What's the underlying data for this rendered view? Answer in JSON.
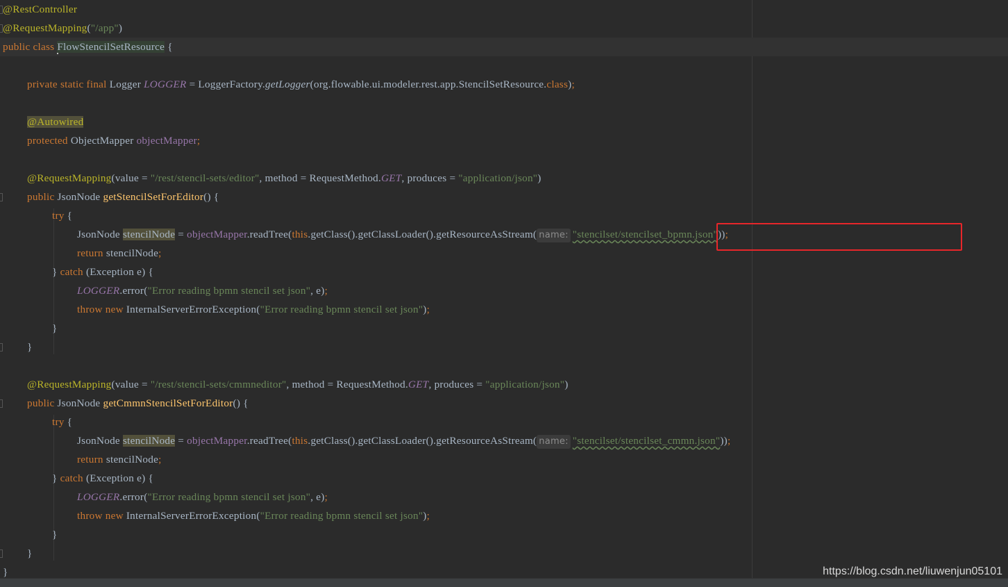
{
  "editor": {
    "class_annotations": [
      "@RestController",
      "@RequestMapping"
    ],
    "request_mapping_path": "\"/app\"",
    "class_decl": {
      "modifiers": "public class ",
      "name": "FlowStencilSetResource",
      "open": " {"
    },
    "logger_line": {
      "modifiers": "private static final ",
      "type": "Logger ",
      "name": "LOGGER",
      "assign": " = LoggerFactory.",
      "method": "getLogger",
      "arg": "(org.flowable.ui.modeler.rest.app.StencilSetResource.",
      "class_kw": "class",
      "close": ")",
      "semi": ";"
    },
    "autowired": "@Autowired",
    "mapper_line": {
      "modifier": "protected ",
      "type": "ObjectMapper ",
      "name": "objectMapper",
      "semi": ";"
    },
    "methods": [
      {
        "annotation": "@RequestMapping",
        "value_key": "(value = ",
        "value": "\"/rest/stencil-sets/editor\"",
        "method_key": ", method = RequestMethod.",
        "method_value": "GET",
        "produces_key": ", produces = ",
        "produces_value": "\"application/json\"",
        "close": ")",
        "signature_mod": "public ",
        "return_type": "JsonNode ",
        "name": "getStencilSetForEditor",
        "sig_close": "() {",
        "try_kw": "try",
        "assign_type": "JsonNode ",
        "var": "stencilNode",
        "assign_mid": " = ",
        "mapper": "objectMapper",
        "read_call": ".readTree(",
        "this_kw": "this",
        "chain": ".getClass().getClassLoader().getResourceAsStream(",
        "hint": "name:",
        "resource": "\"stencilset/stencilset_bpmn.json\"",
        "call_close": "))",
        "return_kw": "return",
        "return_var": " stencilNode",
        "catch_kw": "catch",
        "catch_arg": " (Exception e) {",
        "log_field": "LOGGER",
        "log_call": ".error(",
        "log_msg": "\"Error reading bpmn stencil set json\"",
        "log_tail": ", e)",
        "throw_kw": "throw",
        "new_kw": "new",
        "exception": " InternalServerErrorException(",
        "throw_msg": "\"Error reading bpmn stencil set json\"",
        "throw_close": ")"
      },
      {
        "annotation": "@RequestMapping",
        "value_key": "(value = ",
        "value": "\"/rest/stencil-sets/cmmneditor\"",
        "method_key": ", method = RequestMethod.",
        "method_value": "GET",
        "produces_key": ", produces = ",
        "produces_value": "\"application/json\"",
        "close": ")",
        "signature_mod": "public ",
        "return_type": "JsonNode ",
        "name": "getCmmnStencilSetForEditor",
        "sig_close": "() {",
        "try_kw": "try",
        "assign_type": "JsonNode ",
        "var": "stencilNode",
        "assign_mid": " = ",
        "mapper": "objectMapper",
        "read_call": ".readTree(",
        "this_kw": "this",
        "chain": ".getClass().getClassLoader().getResourceAsStream(",
        "hint": "name:",
        "resource": "\"stencilset/stencilset_cmmn.json\"",
        "call_close": "))",
        "return_kw": "return",
        "return_var": " stencilNode",
        "catch_kw": "catch",
        "catch_arg": " (Exception e) {",
        "log_field": "LOGGER",
        "log_call": ".error(",
        "log_msg": "\"Error reading bpmn stencil set json\"",
        "log_tail": ", e)",
        "throw_kw": "throw",
        "new_kw": "new",
        "exception": " InternalServerErrorException(",
        "throw_msg": "\"Error reading bpmn stencil set json\"",
        "throw_close": ")"
      }
    ],
    "semi": ";",
    "brace_open": "{",
    "brace_close": "}",
    "close_catch": "} ",
    "highlight_box_color": "#e8262a"
  },
  "watermark": "https://blog.csdn.net/liuwenjun05101"
}
